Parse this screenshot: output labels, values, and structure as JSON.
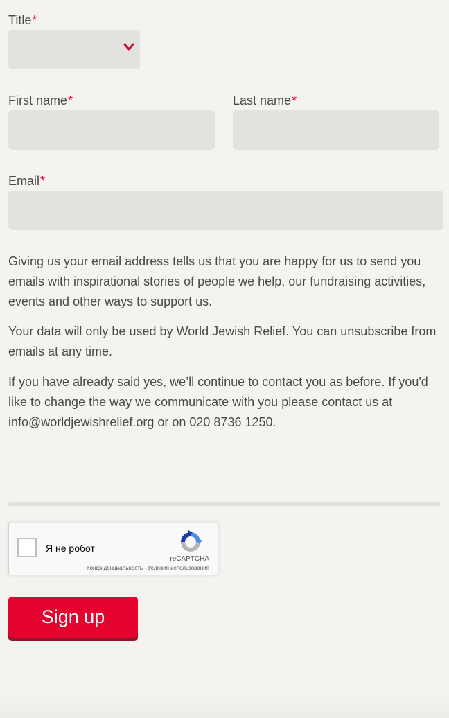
{
  "form": {
    "title_label": "Title",
    "first_name_label": "First name",
    "last_name_label": "Last name",
    "email_label": "Email",
    "required_marker": "*",
    "title_value": "",
    "first_name_value": "",
    "last_name_value": "",
    "email_value": ""
  },
  "consent": {
    "paragraph1": "Giving us your email address tells us that you are happy for us to send you emails with inspirational stories of people we help, our fundraising activities, events and other ways to support us.",
    "paragraph2": "Your data will only be used by World Jewish Relief. You can unsubscribe from emails at any time.",
    "paragraph3": "If you have already said yes, we’ll continue to contact you as before. If you'd like to change the way we communicate with you please contact us at info@worldjewishrelief.org or on 020 8736 1250."
  },
  "captcha": {
    "checkbox_label": "Я не робот",
    "brand": "reCAPTCHA",
    "privacy_link": "Конфиденциальность",
    "separator": " - ",
    "terms_link": "Условия использования",
    "checked": false
  },
  "submit": {
    "label": "Sign up"
  },
  "colors": {
    "background": "#f5f3ef",
    "field": "#e4e2de",
    "accent": "#e4032e",
    "button_shadow": "#8b1a2a",
    "text": "#4a4a4a"
  },
  "icons": {
    "title_dropdown": "chevron-down-icon",
    "captcha": "recaptcha-logo-icon"
  }
}
